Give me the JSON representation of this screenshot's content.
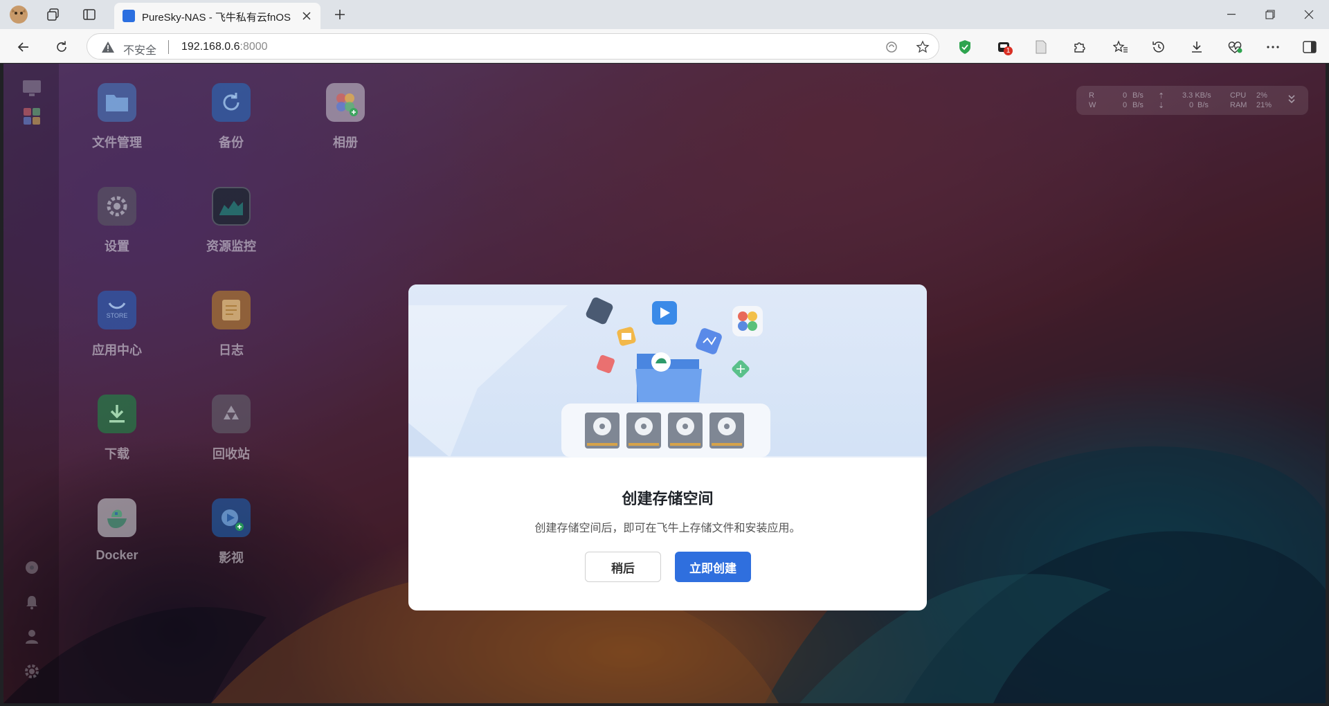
{
  "browser": {
    "tab_title": "PureSky-NAS - 飞牛私有云fnOS",
    "address": {
      "insecure_label": "不安全",
      "host": "192.168.0.6",
      "port": ":8000"
    },
    "extension_badge": "1"
  },
  "desktop": {
    "apps": [
      {
        "label": "文件管理",
        "icon": "folder-icon"
      },
      {
        "label": "备份",
        "icon": "backup-icon"
      },
      {
        "label": "相册",
        "icon": "photos-icon"
      },
      {
        "label": "设置",
        "icon": "settings-icon"
      },
      {
        "label": "资源监控",
        "icon": "monitor-icon"
      },
      {
        "label": "应用中心",
        "icon": "store-icon",
        "sub": "STORE"
      },
      {
        "label": "日志",
        "icon": "log-icon"
      },
      {
        "label": "下载",
        "icon": "download-icon"
      },
      {
        "label": "回收站",
        "icon": "recycle-icon"
      },
      {
        "label": "Docker",
        "icon": "docker-icon"
      },
      {
        "label": "影视",
        "icon": "video-icon"
      }
    ],
    "perf": {
      "r_label": "R",
      "w_label": "W",
      "read": "0",
      "write": "0",
      "unit": "B/s",
      "up": "3.3 KB/s",
      "down": "0",
      "down_unit": "B/s",
      "cpu_label": "CPU",
      "cpu": "2%",
      "ram_label": "RAM",
      "ram": "21%"
    }
  },
  "modal": {
    "title": "创建存储空间",
    "description": "创建存储空间后，即可在飞牛上存储文件和安装应用。",
    "later_button": "稍后",
    "create_button": "立即创建"
  }
}
